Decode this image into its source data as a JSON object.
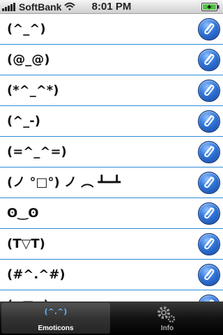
{
  "status_bar": {
    "carrier": "SoftBank",
    "time": "8:01 PM"
  },
  "list": {
    "items": [
      {
        "text": "(^_^)"
      },
      {
        "text": "(@_@)"
      },
      {
        "text": "(*^_^*)"
      },
      {
        "text": "(^_-)"
      },
      {
        "text": "(=^_^=)"
      },
      {
        "text": "(ノ °□°) ノ ︵ ┻━┻"
      },
      {
        "text": "ʘ‿ʘ"
      },
      {
        "text": "(T▽T)"
      },
      {
        "text": "(#^.^#)"
      },
      {
        "text": "(≧▽≦)"
      }
    ],
    "row_icon": "paperclip-icon"
  },
  "tab_bar": {
    "tabs": [
      {
        "label": "Emoticons",
        "icon_text": "(^.^)",
        "selected": true
      },
      {
        "label": "Info",
        "icon": "gear-icon",
        "selected": false
      }
    ]
  },
  "colors": {
    "accent": "#2a8bd6",
    "tab_bar": "#121212",
    "button_blue": "#2f74d6"
  }
}
